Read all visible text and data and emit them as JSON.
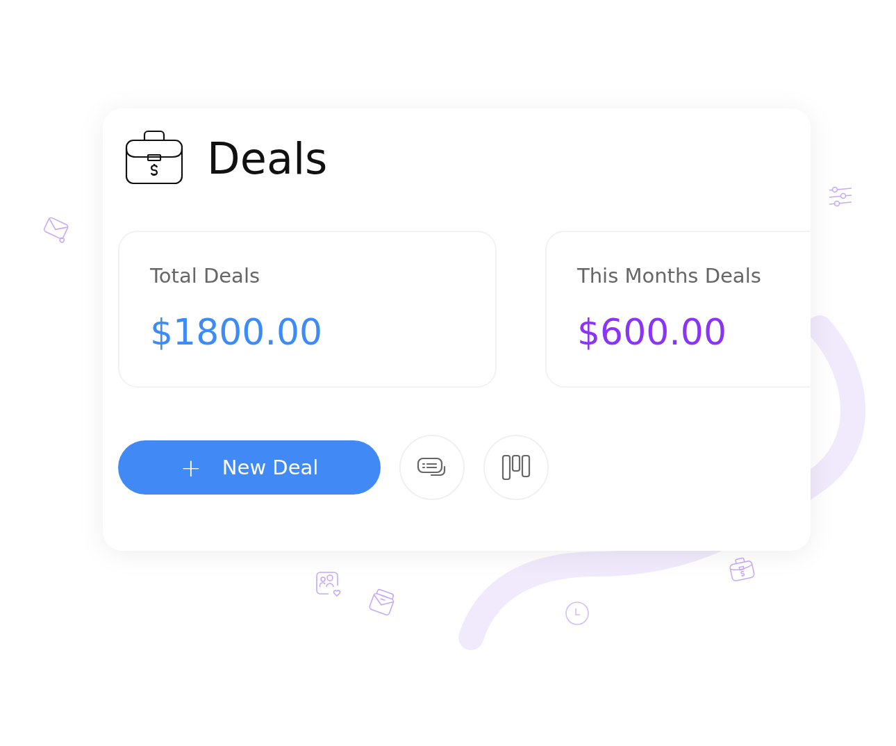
{
  "title": "Deals",
  "stats": [
    {
      "label": "Total Deals",
      "value": "$1800.00",
      "color": "#3d8cf6"
    },
    {
      "label": "This Months Deals",
      "value": "$600.00",
      "color": "#8a34f5"
    }
  ],
  "new_deal_button": {
    "icon": "+",
    "label": "New Deal"
  }
}
